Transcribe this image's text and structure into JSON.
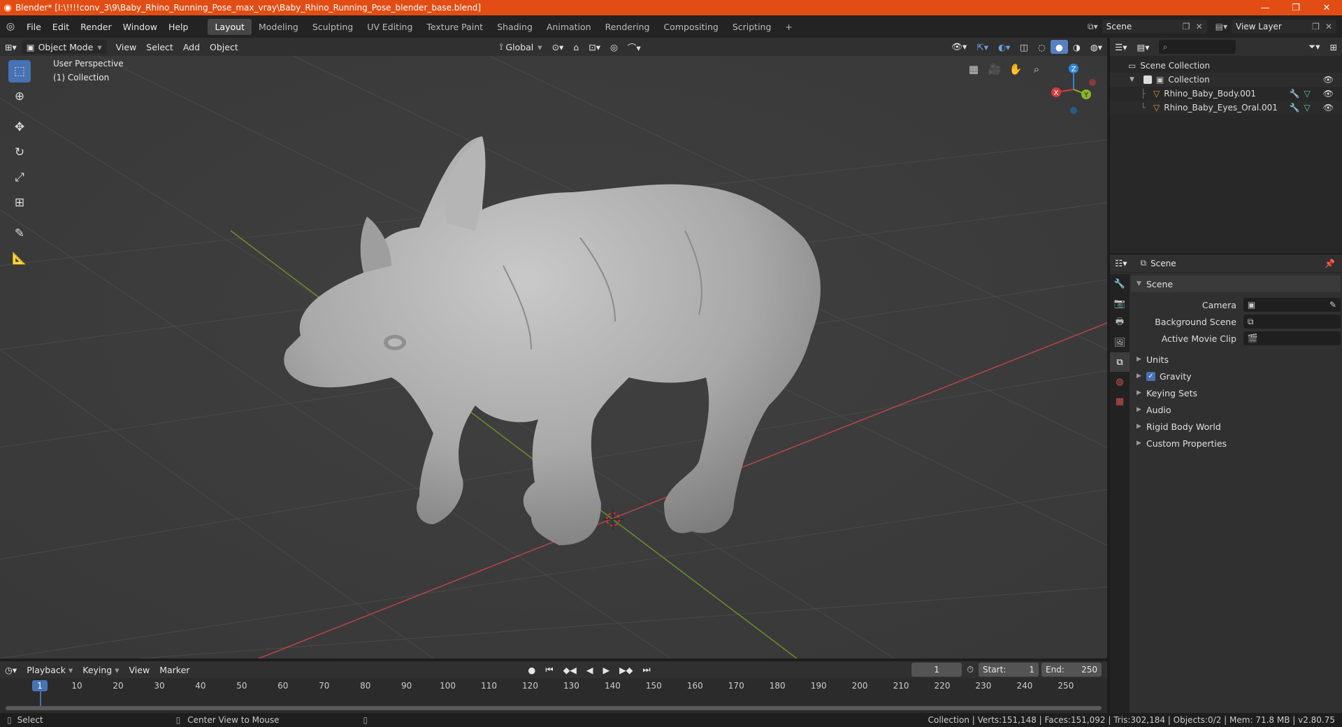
{
  "window": {
    "title": "Blender* [I:\\!!!!conv_3\\9\\Baby_Rhino_Running_Pose_max_vray\\Baby_Rhino_Running_Pose_blender_base.blend]",
    "minimize": "—",
    "maximize": "❐",
    "close": "✕"
  },
  "menu": {
    "items": [
      "File",
      "Edit",
      "Render",
      "Window",
      "Help"
    ],
    "workspaces": [
      "Layout",
      "Modeling",
      "Sculpting",
      "UV Editing",
      "Texture Paint",
      "Shading",
      "Animation",
      "Rendering",
      "Compositing",
      "Scripting"
    ],
    "active_workspace": "Layout",
    "add_workspace": "+",
    "scene_name": "Scene",
    "view_layer": "View Layer"
  },
  "viewport_header": {
    "mode": "Object Mode",
    "menus": [
      "View",
      "Select",
      "Add",
      "Object"
    ],
    "transform_orientation": "Global"
  },
  "viewport": {
    "perspective_label": "User Perspective",
    "collection_label": "(1) Collection",
    "gizmo": {
      "z": "Z",
      "y": "Y",
      "x": "X"
    }
  },
  "outliner": {
    "root": "Scene Collection",
    "collection": "Collection",
    "objects": [
      "Rhino_Baby_Body.001",
      "Rhino_Baby_Eyes_Oral.001"
    ]
  },
  "properties": {
    "context": "Scene",
    "panel_title": "Scene",
    "fields": [
      {
        "label": "Camera",
        "value": ""
      },
      {
        "label": "Background Scene",
        "value": ""
      },
      {
        "label": "Active Movie Clip",
        "value": ""
      }
    ],
    "panels": [
      "Units",
      "Gravity",
      "Keying Sets",
      "Audio",
      "Rigid Body World",
      "Custom Properties"
    ],
    "gravity_checked": true
  },
  "timeline": {
    "menus": [
      "Playback",
      "Keying",
      "View",
      "Marker"
    ],
    "current_frame": "1",
    "start_label": "Start:",
    "start": "1",
    "end_label": "End:",
    "end": "250",
    "ticks": [
      "1",
      "10",
      "20",
      "30",
      "40",
      "50",
      "60",
      "70",
      "80",
      "90",
      "100",
      "110",
      "120",
      "130",
      "140",
      "150",
      "160",
      "170",
      "180",
      "190",
      "200",
      "210",
      "220",
      "230",
      "240",
      "250"
    ]
  },
  "status": {
    "left_action": "Select",
    "middle_action": "Center View to Mouse",
    "stats": "Collection | Verts:151,148 | Faces:151,092 | Tris:302,184 | Objects:0/2 | Mem: 71.8 MB | v2.80.75"
  },
  "colors": {
    "titlebar": "#e14d14",
    "accent": "#4772b3",
    "x_axis": "#d63a3a",
    "y_axis": "#8ab62a",
    "z_axis": "#2e86d0"
  }
}
